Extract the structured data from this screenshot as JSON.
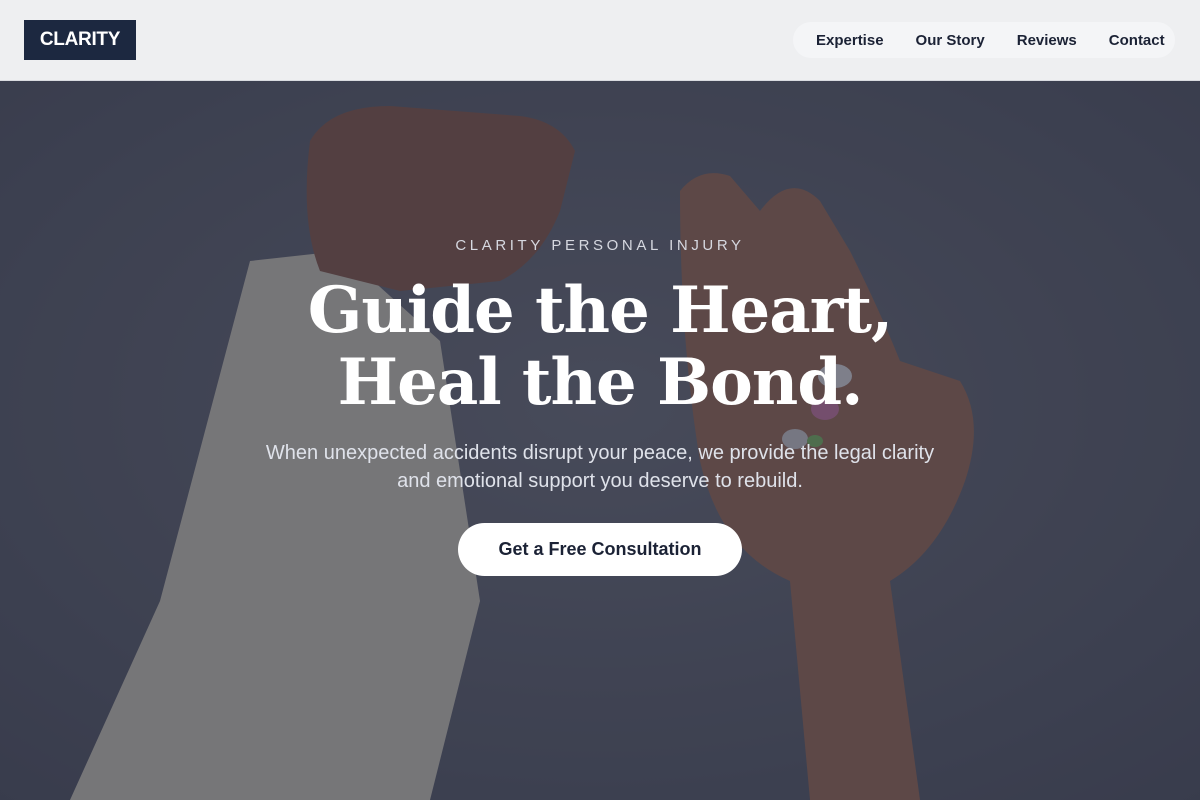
{
  "header": {
    "logo": "CLARITY",
    "nav": [
      {
        "label": "Expertise"
      },
      {
        "label": "Our Story"
      },
      {
        "label": "Reviews"
      },
      {
        "label": "Contact"
      }
    ]
  },
  "hero": {
    "eyebrow": "CLARITY PERSONAL INJURY",
    "headline_line1": "Guide the Heart,",
    "headline_line2": "Heal the Bond.",
    "subtext": "When unexpected accidents disrupt your peace, we provide the legal clarity and emotional support you deserve to rebuild.",
    "cta_label": "Get a Free Consultation",
    "background_image": "photo of a bandaged arm and an open hand holding pills on a gray concrete surface"
  },
  "colors": {
    "logo_bg": "#1c2840",
    "header_bg": "#eeeff1",
    "nav_pill_bg": "#f4f5f7",
    "text_dark": "#1b2235",
    "hero_overlay": "#262a3c",
    "cta_bg": "#ffffff"
  }
}
